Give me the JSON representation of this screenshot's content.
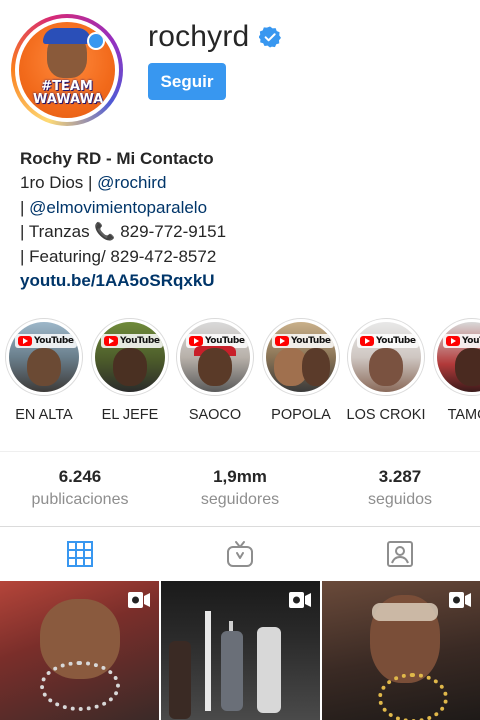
{
  "profile": {
    "username": "rochyrd",
    "follow_label": "Seguir",
    "avatar_text": "#TEAM WAWAWA"
  },
  "bio": {
    "name": "Rochy RD - Mi Contacto",
    "line2_prefix": "1ro Dios | ",
    "line2_mention": "@rochird",
    "line3_prefix": "| ",
    "line3_mention": "@elmovimientoparalelo",
    "line4": "| Tranzas 📞 829-772-9151",
    "line5": "| Featuring/ 829-472-8572",
    "link": "youtu.be/1AA5oSRqxkU"
  },
  "highlights": [
    {
      "label": "EN ALTA",
      "badge": "YouTube"
    },
    {
      "label": "EL JEFE",
      "badge": "YouTube"
    },
    {
      "label": "SAOCO",
      "badge": "YouTube"
    },
    {
      "label": "POPOLA",
      "badge": "YouTube"
    },
    {
      "label": "LOS CROKI",
      "badge": "YouTube"
    },
    {
      "label": "TAMO I",
      "badge": "YouTube"
    }
  ],
  "stats": [
    {
      "value": "6.246",
      "label": "publicaciones"
    },
    {
      "value": "1,9mm",
      "label": "seguidores"
    },
    {
      "value": "3.287",
      "label": "seguidos"
    }
  ],
  "tabs": [
    {
      "icon": "grid-icon"
    },
    {
      "icon": "igtv-icon"
    },
    {
      "icon": "tagged-icon"
    }
  ],
  "colors": {
    "follow_button": "#3897f0",
    "active_tab": "#3897f0",
    "mention": "#003569",
    "muted": "#8e8e8e"
  }
}
